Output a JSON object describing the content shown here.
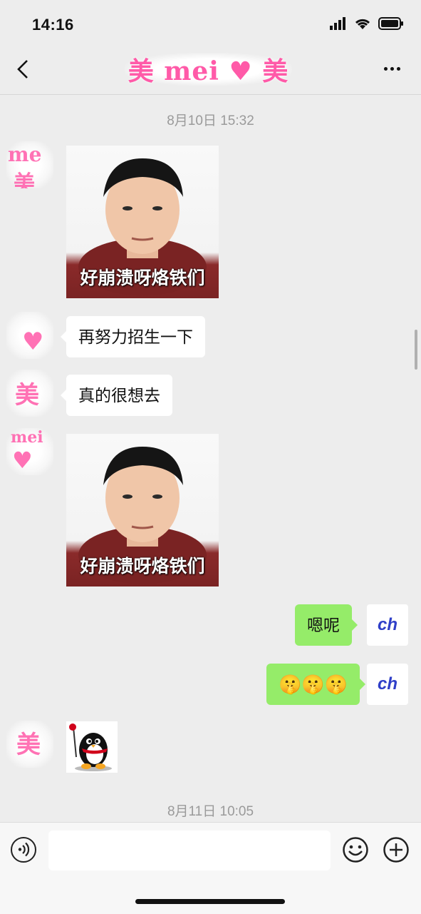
{
  "status_bar": {
    "time": "14:16"
  },
  "header": {
    "title": "美 mei ♥ 美"
  },
  "timestamps": [
    "8月10日 15:32",
    "8月11日 10:05"
  ],
  "messages": {
    "m1": {
      "caption": "好崩溃呀烙铁们"
    },
    "m2": {
      "text": "再努力招生一下"
    },
    "m3": {
      "text": "真的很想去"
    },
    "m4": {
      "caption": "好崩溃呀烙铁们"
    },
    "m5": {
      "text": "嗯呢"
    },
    "m6": {
      "text": "🤫🤫🤫"
    }
  },
  "my_avatar": {
    "text": "ch"
  },
  "colors": {
    "background": "#ededed",
    "sent_bubble": "#95ec69",
    "received_bubble": "#ffffff",
    "accent_pink": "#ff5aa8",
    "avatar_blue": "#2f3fc8"
  },
  "icons": {
    "back": "chevron-left-icon",
    "more": "more-dots-icon",
    "voice": "voice-icon",
    "emoji": "emoji-icon",
    "plus": "plus-icon"
  }
}
